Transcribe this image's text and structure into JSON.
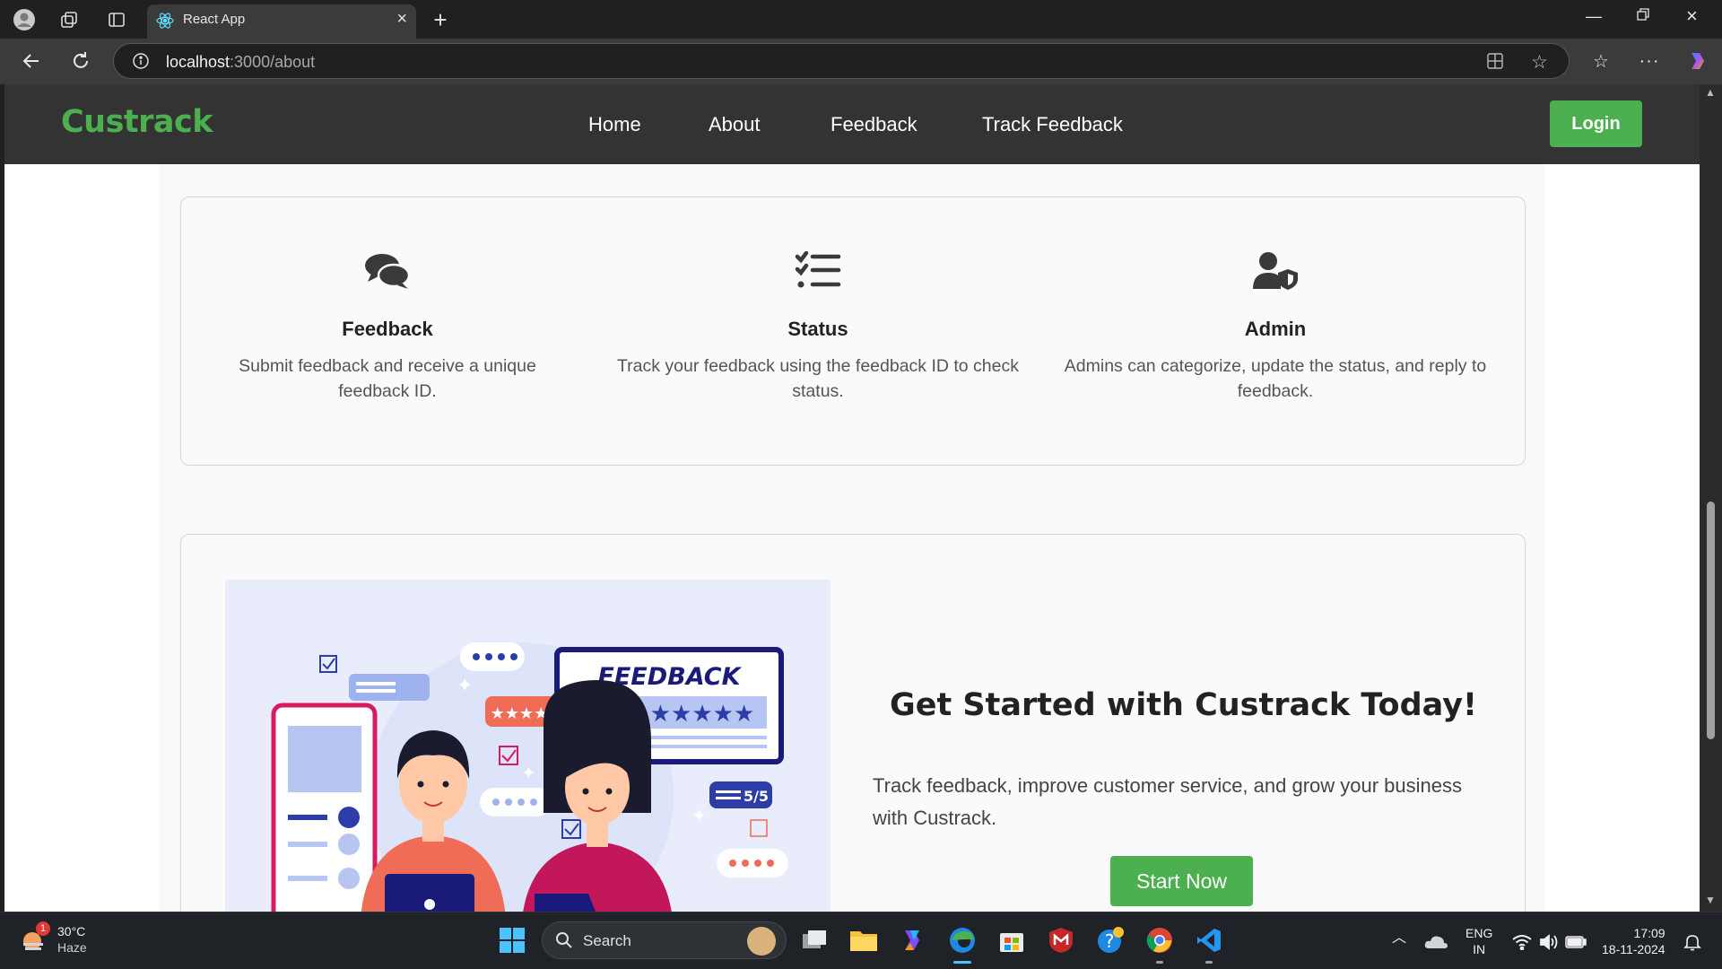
{
  "browser": {
    "tab_title": "React App",
    "url_host": "localhost",
    "url_path": ":3000/about"
  },
  "header": {
    "brand": "Custrack",
    "menu": [
      "Home",
      "About",
      "Feedback",
      "Track Feedback"
    ],
    "login_label": "Login"
  },
  "features": [
    {
      "icon": "comments-icon",
      "title": "Feedback",
      "desc_line1": "Submit feedback and receive a unique",
      "desc_line2": "feedback ID."
    },
    {
      "icon": "tasks-list-icon",
      "title": "Status",
      "desc_line1": "Track your feedback using the feedback ID to check",
      "desc_line2": "status."
    },
    {
      "icon": "user-shield-icon",
      "title": "Admin",
      "desc_line1": "Admins can categorize, update the status, and reply to",
      "desc_line2": "feedback."
    }
  ],
  "cta": {
    "title": "Get Started with Custrack Today!",
    "desc_line1": "Track feedback, improve customer service, and grow your business",
    "desc_line2": "with Custrack.",
    "button": "Start Now",
    "illustration": {
      "banner": "FEEDBACK",
      "score": "5/5"
    }
  },
  "taskbar": {
    "weather_temp": "30°C",
    "weather_desc": "Haze",
    "weather_badge": "1",
    "search_label": "Search",
    "lang_line1": "ENG",
    "lang_line2": "IN",
    "time": "17:09",
    "date": "18-11-2024"
  },
  "colors": {
    "brand_green": "#4caf50",
    "header_bg": "#333333",
    "illustration_bg": "#e8ecfb",
    "illustration_navy": "#1a1a7a"
  }
}
